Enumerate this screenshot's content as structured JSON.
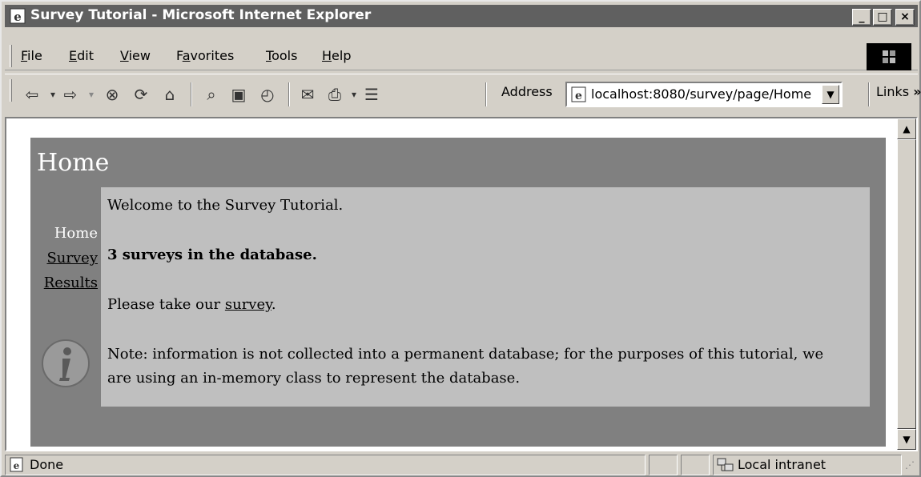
{
  "window": {
    "title": "Survey Tutorial - Microsoft Internet Explorer",
    "icon": "ie-logo-icon",
    "controls": [
      "_",
      "□",
      "×"
    ]
  },
  "menu": {
    "items": [
      {
        "label": "File",
        "accel": "F",
        "rest": "ile"
      },
      {
        "label": "Edit",
        "accel": "E",
        "rest": "dit"
      },
      {
        "label": "View",
        "accel": "V",
        "rest": "iew"
      },
      {
        "label": "Favorites",
        "pre": "F",
        "accel": "a",
        "rest": "vorites"
      },
      {
        "label": "Tools",
        "accel": "T",
        "rest": "ools"
      },
      {
        "label": "Help",
        "accel": "H",
        "rest": "elp"
      }
    ]
  },
  "toolbar": {
    "icons": [
      "back-icon",
      "forward-icon",
      "stop-icon",
      "refresh-icon",
      "home-icon",
      "search-icon",
      "favorites-icon",
      "history-icon",
      "print-icon",
      "edit-icon",
      "discuss-icon"
    ],
    "address_label": "Address",
    "address_value": "localhost:8080/survey/page/Home",
    "links_label": "Links"
  },
  "page": {
    "title": "Home",
    "nav": {
      "current": "Home",
      "links": [
        "Survey",
        "Results"
      ]
    },
    "content": {
      "welcome": "Welcome to the Survey Tutorial.",
      "count": "3 surveys in the database.",
      "take_prefix": "Please take our ",
      "take_link": "survey",
      "take_suffix": ".",
      "note": "Note: information is not collected into a permanent database; for the purposes of this tutorial, we are using an in-memory class to represent the database."
    }
  },
  "status": {
    "text": "Done",
    "zone": "Local intranet"
  },
  "colors": {
    "title_bar": "#606060",
    "chrome": "#d4d0c8",
    "page_bg": "#808080",
    "content_bg": "#bfbfbf"
  }
}
